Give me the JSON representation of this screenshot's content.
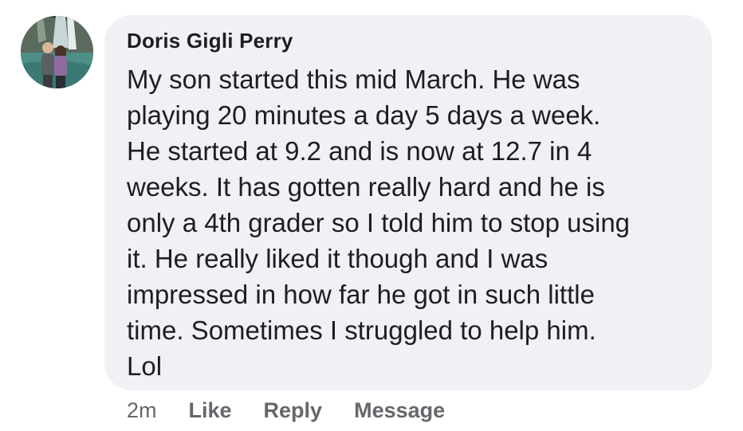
{
  "comment": {
    "author": "Doris Gigli Perry",
    "avatar_icon": "profile-photo-waterfall",
    "body_lines": [
      "My son started this mid March.  He was",
      "playing 20 minutes a day 5 days a week.",
      "He started at 9.2 and is now at 12.7 in 4",
      "weeks.  It has gotten really hard and he is",
      "only a 4th grader so I told him to stop using",
      "it.  He really liked it though and I was",
      "impressed in how far he got in such little",
      "time.  Sometimes I struggled to help him.",
      "Lol"
    ]
  },
  "actions": {
    "timestamp": "2m",
    "like_label": "Like",
    "reply_label": "Reply",
    "message_label": "Message"
  },
  "colors": {
    "bubble_bg": "#f0f1f4",
    "text": "#1c1e21",
    "secondary_text": "#65676b"
  }
}
